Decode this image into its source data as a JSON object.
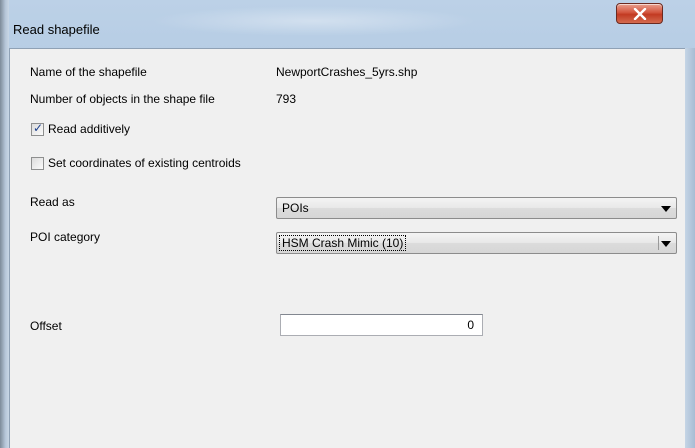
{
  "window": {
    "title": "Read shapefile",
    "close_icon": "close-x-icon"
  },
  "fields": {
    "shapefile_name_label": "Name of the shapefile",
    "shapefile_name_value": "NewportCrashes_5yrs.shp",
    "object_count_label": "Number of objects in the shape file",
    "object_count_value": "793"
  },
  "options": {
    "read_additively": {
      "label": "Read additively",
      "checked": true
    },
    "set_centroids": {
      "label": "Set coordinates of existing centroids",
      "checked": false
    }
  },
  "read_as": {
    "label": "Read as",
    "selected": "POIs"
  },
  "poi_category": {
    "label": "POI category",
    "selected": "HSM Crash Mimic (10)"
  },
  "offset": {
    "label": "Offset",
    "value": "0"
  },
  "colors": {
    "dialog_bg": "#f0f0f0",
    "title_bar": "#b2c8e0",
    "close_button": "#c9462d",
    "check_mark": "#1c3f8c"
  }
}
